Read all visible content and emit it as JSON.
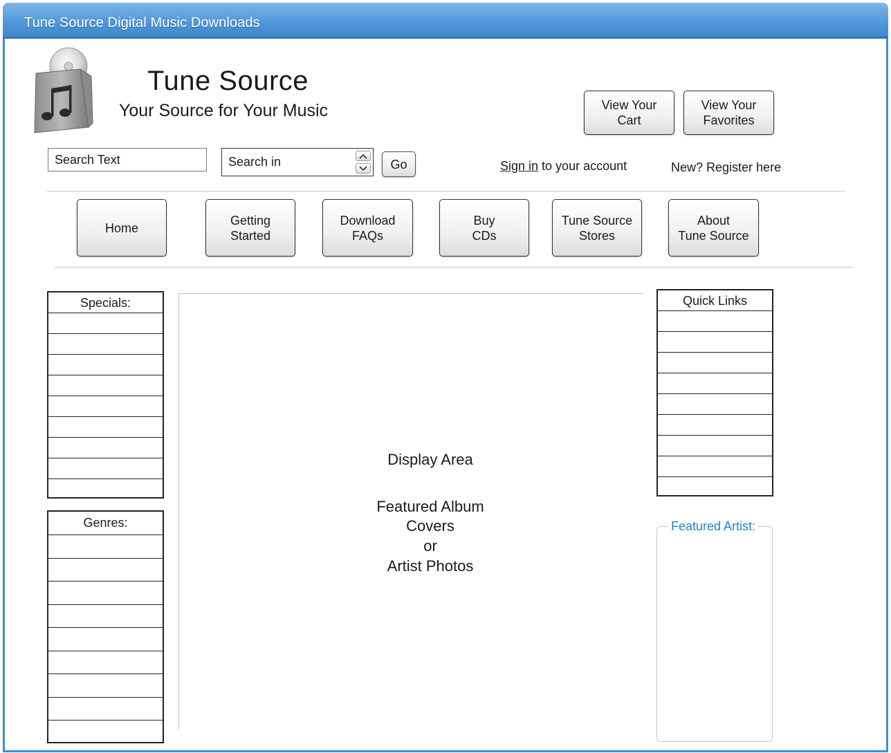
{
  "window": {
    "title": "Tune Source Digital Music Downloads"
  },
  "header": {
    "brand": "Tune Source",
    "tagline": "Your Source for Your Music",
    "view_cart": "View Your\nCart",
    "view_favorites": "View Your\nFavorites"
  },
  "search": {
    "text_value": "Search Text",
    "search_in_value": "Search in",
    "go_label": "Go"
  },
  "account": {
    "sign_in_link": "Sign in",
    "sign_in_suffix": " to your account",
    "register": "New? Register here"
  },
  "nav": {
    "items": [
      {
        "label": "Home"
      },
      {
        "label": "Getting\nStarted"
      },
      {
        "label": "Download\nFAQs"
      },
      {
        "label": "Buy\nCDs"
      },
      {
        "label": "Tune Source\nStores"
      },
      {
        "label": "About\nTune Source"
      }
    ]
  },
  "sidebar_left": {
    "specials_title": "Specials:",
    "genres_title": "Genres:"
  },
  "display": {
    "line1": "Display Area",
    "line2": "Featured Album",
    "line3": "Covers",
    "line4": "or",
    "line5": "Artist Photos"
  },
  "sidebar_right": {
    "quick_links_title": "Quick Links",
    "featured_artist_title": "Featured Artist:"
  },
  "colors": {
    "titlebar": "#4f97d8",
    "frame_border": "#3f8fd2",
    "legend_text": "#1f86c7"
  },
  "icons": {
    "logo": "music-bag-icon",
    "spin_up": "chevron-up-icon",
    "spin_down": "chevron-down-icon"
  }
}
